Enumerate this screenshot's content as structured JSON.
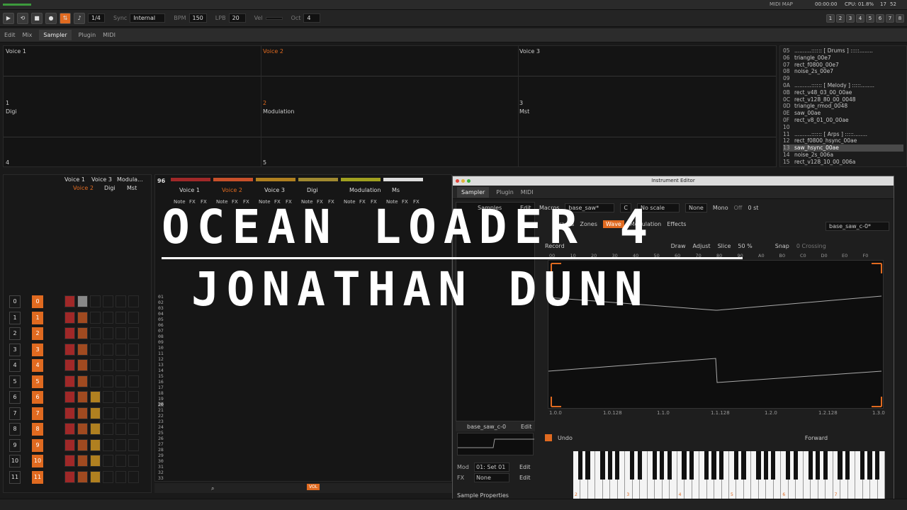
{
  "topbar": {
    "midi_map": "MIDI MAP",
    "time": "00:00:00",
    "cpu": "CPU: 01.8%",
    "clock_h": "17",
    "clock_m": "52"
  },
  "transport": {
    "pattern_step": "1/4",
    "sync_label": "Sync",
    "sync_value": "Internal",
    "bpm_label": "BPM",
    "bpm_value": "150",
    "lpb_label": "LPB",
    "lpb_value": "20",
    "vel_label": "Vel",
    "oct_label": "Oct",
    "oct_value": "4"
  },
  "tabs": [
    "Edit",
    "Mix",
    "Sampler",
    "Plugin",
    "MIDI"
  ],
  "track_numbers": [
    "1",
    "2",
    "3",
    "4",
    "5",
    "6",
    "7",
    "8"
  ],
  "tracks_overview": {
    "row1": [
      "Voice 1",
      "Voice 2",
      "Voice 3"
    ],
    "row1_numbers": [
      "1",
      "2",
      "3"
    ],
    "row2": [
      "Digi",
      "Modulation",
      "Mst"
    ],
    "row2_numbers": [
      "4",
      "5"
    ]
  },
  "instrument_list": [
    {
      "n": "05",
      "name": "..........:::::: [ Drums  ] :::::........"
    },
    {
      "n": "06",
      "name": "triangle_00e7"
    },
    {
      "n": "07",
      "name": "rect_f0800_00e7"
    },
    {
      "n": "08",
      "name": "noise_2s_00e7"
    },
    {
      "n": "09",
      "name": ""
    },
    {
      "n": "0A",
      "name": "..........:::::: [ Melody ] :::::........"
    },
    {
      "n": "0B",
      "name": "rect_v48_03_00_00ae"
    },
    {
      "n": "0C",
      "name": "rect_v128_80_00_0048"
    },
    {
      "n": "0D",
      "name": "triangle_rmod_0048"
    },
    {
      "n": "0E",
      "name": "saw_00ae"
    },
    {
      "n": "0F",
      "name": "rect_v8_01_00_00ae"
    },
    {
      "n": "10",
      "name": ""
    },
    {
      "n": "11",
      "name": "..........:::::: [ Arps   ] :::::........"
    },
    {
      "n": "12",
      "name": "rect_f0800_hsync_00ae"
    },
    {
      "n": "13",
      "name": "saw_hsync_00ae"
    },
    {
      "n": "14",
      "name": "noise_2s_006a"
    },
    {
      "n": "15",
      "name": "rect_v128_10_00_006a"
    }
  ],
  "matrix": {
    "headers": [
      "Voice 1",
      "Voice 3",
      "Modula...",
      "Voice 2",
      "Digi",
      "Mst"
    ],
    "row_numbers": [
      "0",
      "1",
      "2",
      "3",
      "4",
      "5",
      "6",
      "7",
      "8",
      "9",
      "10",
      "11"
    ]
  },
  "pattern": {
    "pattern_num": "96",
    "columns": [
      "Voice 1",
      "Voice 2",
      "Voice 3",
      "Digi",
      "Modulation",
      "Ms"
    ],
    "subcols": [
      "Note",
      "FX",
      "FX"
    ],
    "sample_lines": [
      "01",
      "02",
      "03",
      "04",
      "05",
      "06",
      "07",
      "08",
      "09",
      "10",
      "11",
      "12",
      "13",
      "14",
      "15",
      "16",
      "17",
      "18",
      "19",
      "20",
      "21",
      "22",
      "23",
      "24",
      "25",
      "26",
      "27",
      "28",
      "29",
      "30",
      "31",
      "32",
      "33"
    ]
  },
  "instrument_editor": {
    "title": "Instrument Editor",
    "tabs": [
      "Sampler",
      "Plugin",
      "MIDI"
    ],
    "samples_label": "Samples",
    "edit_label": "Edit",
    "macros_label": "Macros",
    "sample_name": "base_saw*",
    "key": "C",
    "scale": "No scale",
    "none_label": "None",
    "mono_label": "Mono",
    "off_label": "Off",
    "st_label": "0 st",
    "phrases_label": "Phrases",
    "zones_label": "Zones",
    "wave_label": "Wave",
    "modulation_label": "Modulation",
    "effects_label": "Effects",
    "sample_select": "base_saw_c-0*",
    "record_label": "Record",
    "draw_label": "Draw",
    "adjust_label": "Adjust",
    "slice_label": "Slice",
    "zoom": "50 %",
    "snap_label": "Snap",
    "zero_crossing": "0 Crossing",
    "sample_item": "base_saw_c-0",
    "ruler": [
      "00",
      "10",
      "20",
      "30",
      "40",
      "50",
      "60",
      "70",
      "80",
      "90",
      "A0",
      "B0",
      "C0",
      "D0",
      "E0",
      "F0"
    ],
    "time_ticks": [
      "1.0.0",
      "1.0.128",
      "1.1.0",
      "1.1.128",
      "1.2.0",
      "1.2.128",
      "1.3.0"
    ],
    "undo_label": "Undo",
    "forward_label": "Forward",
    "mod_label": "Mod",
    "mod_value": "01: Set 01",
    "fx_label": "FX",
    "fx_value": "None",
    "sample_properties": "Sample Properties",
    "octave_marks": [
      "2",
      "3",
      "4",
      "5",
      "6",
      "7"
    ]
  },
  "overlay": {
    "line1": "OCEAN LOADER 4",
    "line2": "JONATHAN DUNN"
  },
  "colors": {
    "accent": "#e06a20",
    "selected_track": "#c8502a",
    "voice1": "#a02828",
    "voice3": "#b08020",
    "digi": "#a08a30",
    "modulation": "#a0a020"
  }
}
